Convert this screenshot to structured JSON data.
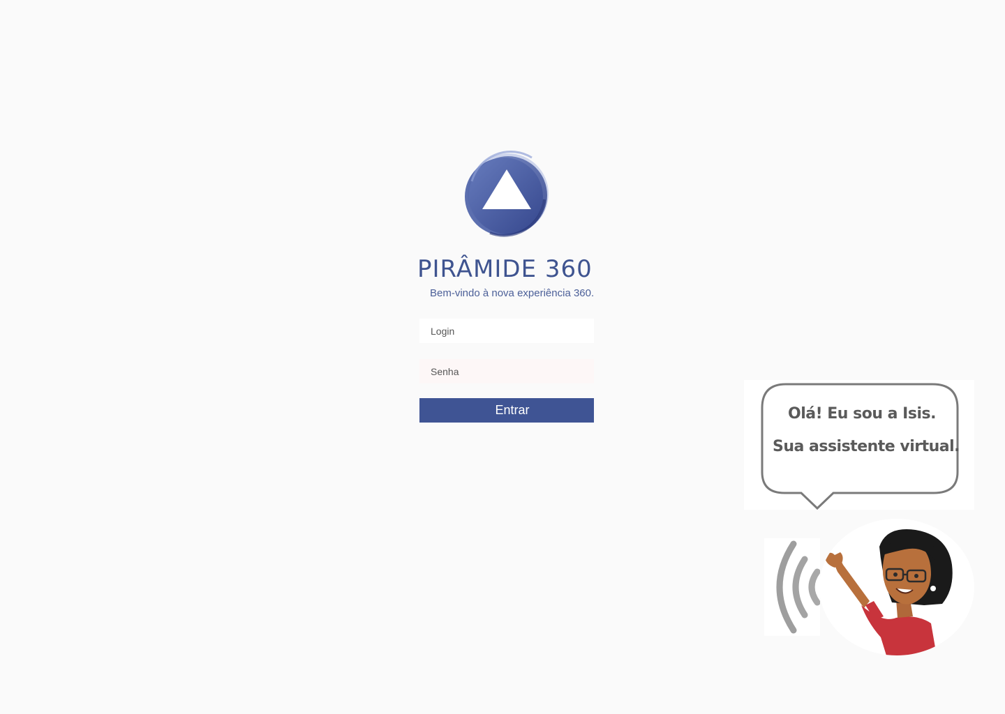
{
  "brand": {
    "name": "PIRÂMIDE 360",
    "tagline": "Bem-vindo à nova experiência 360."
  },
  "login_form": {
    "login_placeholder": "Login",
    "password_placeholder": "Senha",
    "submit_label": "Entrar"
  },
  "assistant": {
    "greeting_line_1": "Olá! Eu sou a Isis.",
    "greeting_line_2": "Sua assistente virtual."
  },
  "colors": {
    "brand_blue": "#3f5494",
    "background": "#fafafa",
    "bubble_text": "#5a5a5a"
  },
  "icons": {
    "logo": "pyramid-logo-icon",
    "sound": "sound-waves-icon",
    "avatar": "assistant-avatar"
  }
}
